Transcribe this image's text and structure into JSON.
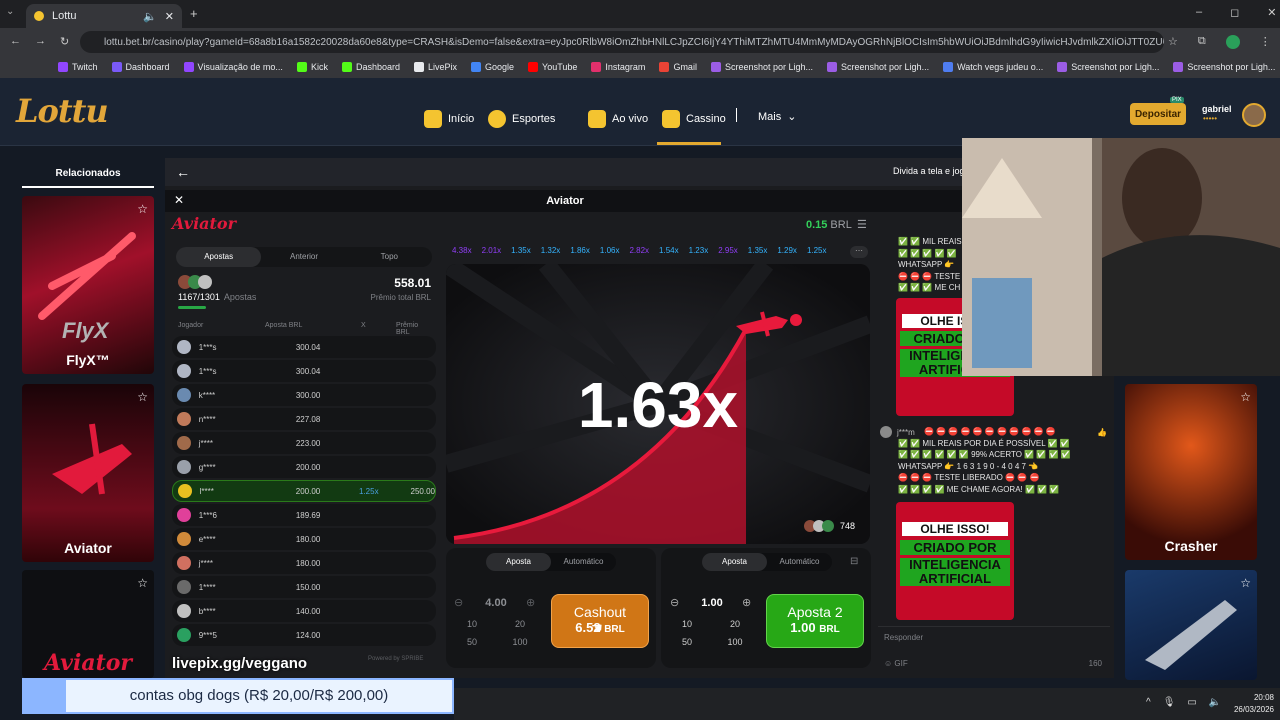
{
  "browser": {
    "tab_title": "Lottu",
    "url": "lottu.bet.br/casino/play?gameId=68a8b16a1582c20028da60e8&type=CRASH&isDemo=false&extra=eyJpc0RlbW8iOmZhbHNlLCJpZCI6IjY4YThiMTZhMTU4MmMyMDAyOGRhNjBlOCIsIm5hbWUiOiJBdmlhdG9yIiwicHJvdmlkZXIiOiJTT0ZUU1dJU1MiLCJpbWFn...",
    "bookmarks": [
      "Twitch",
      "Dashboard",
      "Visualização de mo...",
      "Kick",
      "Dashboard",
      "LivePix",
      "Google",
      "YouTube",
      "Instagram",
      "Gmail",
      "Screenshot por Ligh...",
      "Screenshot por Ligh...",
      "Watch vegs judeu o...",
      "Screenshot por Ligh...",
      "Screenshot por Ligh..."
    ]
  },
  "site": {
    "logo": "Lottu",
    "nav": [
      "Início",
      "Esportes",
      "Ao vivo",
      "Cassino",
      "Mais"
    ],
    "deposit_label": "Depositar",
    "pix_badge": "PIX",
    "user": "gabriel",
    "user_stars": "•••••",
    "split_screen": "Divida a tela e jog"
  },
  "related": {
    "title": "Relacionados",
    "games": [
      "FlyX™",
      "Aviator",
      "Aviator"
    ],
    "right_games": [
      "Crasher"
    ]
  },
  "game": {
    "title": "Aviator",
    "logo": "Aviator",
    "balance": "0.15",
    "currency": "BRL",
    "tabs": [
      "Apostas",
      "Anterior",
      "Topo"
    ],
    "total_bets": "1167/1301",
    "bets_label": "Apostas",
    "total_prize": "558.01",
    "prize_label": "Prêmio total BRL",
    "columns": [
      "Jogador",
      "Aposta BRL",
      "X",
      "Prêmio BRL"
    ],
    "players": [
      {
        "name": "1***s",
        "bet": "300.04",
        "mult": "",
        "prize": ""
      },
      {
        "name": "1***s",
        "bet": "300.04",
        "mult": "",
        "prize": ""
      },
      {
        "name": "k****",
        "bet": "300.00",
        "mult": "",
        "prize": ""
      },
      {
        "name": "n****",
        "bet": "227.08",
        "mult": "",
        "prize": ""
      },
      {
        "name": "j****",
        "bet": "223.00",
        "mult": "",
        "prize": ""
      },
      {
        "name": "g****",
        "bet": "200.00",
        "mult": "",
        "prize": ""
      },
      {
        "name": "l****",
        "bet": "200.00",
        "mult": "1.25x",
        "prize": "250.00"
      },
      {
        "name": "1***6",
        "bet": "189.69",
        "mult": "",
        "prize": ""
      },
      {
        "name": "e****",
        "bet": "180.00",
        "mult": "",
        "prize": ""
      },
      {
        "name": "j****",
        "bet": "180.00",
        "mult": "",
        "prize": ""
      },
      {
        "name": "1****",
        "bet": "150.00",
        "mult": "",
        "prize": ""
      },
      {
        "name": "b****",
        "bet": "140.00",
        "mult": "",
        "prize": ""
      },
      {
        "name": "9***5",
        "bet": "124.00",
        "mult": "",
        "prize": ""
      }
    ],
    "powered": "Powered by SPRIBE",
    "history": [
      "4.38x",
      "2.01x",
      "1.35x",
      "1.32x",
      "1.86x",
      "1.06x",
      "2.82x",
      "1.54x",
      "1.23x",
      "2.95x",
      "1.35x",
      "1.29x",
      "1.25x",
      "1."
    ],
    "current_multiplier": "1.63x",
    "players_online": "748",
    "panel1": {
      "tabs": [
        "Aposta",
        "Automático"
      ],
      "amount": "4.00",
      "quick": [
        "10",
        "20",
        "50",
        "100"
      ],
      "button_title": "Cashout",
      "button_value": "6.52",
      "button_currency": "BRL"
    },
    "panel2": {
      "tabs": [
        "Aposta",
        "Automático"
      ],
      "amount": "1.00",
      "quick": [
        "10",
        "20",
        "50",
        "100"
      ],
      "button_title": "Aposta 2",
      "button_value": "1.00",
      "button_currency": "BRL"
    }
  },
  "chat": {
    "lines_top": [
      "✅ ✅ MIL REAIS",
      "✅ ✅ ✅ ✅ ✅",
      "WHATSAPP 👉",
      "⛔ ⛔ ⛔ TESTE",
      "✅ ✅ ✅ ME CH"
    ],
    "user": "j***m",
    "lines": [
      "⛔ ⛔ ⛔ ⛔ ⛔ ⛔ ⛔ ⛔ ⛔ ⛔ ⛔",
      "✅ ✅ MIL REAIS POR DIA É POSSÍVEL ✅ ✅",
      "✅ ✅ ✅ ✅ ✅ ✅ 99% ACERTO ✅ ✅ ✅ ✅",
      "WHATSAPP 👉 1 6    3 1 9 0 - 4 0 4 7 👈",
      "⛔ ⛔ ⛔ TESTE LIBERADO ⛔ ⛔ ⛔",
      "✅ ✅ ✅ ✅ ME CHAME AGORA! ✅ ✅ ✅"
    ],
    "promo": [
      "OLHE ISSO!",
      "CRIADO POR",
      "INTELIGENCIA",
      "ARTIFICIAL"
    ],
    "reply_placeholder": "Responder",
    "char_count": "160"
  },
  "overlay": {
    "stream_tag": "livepix.gg/veggano",
    "donation": "contas obg dogs (R$ 20,00/R$ 200,00)"
  },
  "taskbar": {
    "time": "20:08",
    "date": "26/03/2026"
  }
}
